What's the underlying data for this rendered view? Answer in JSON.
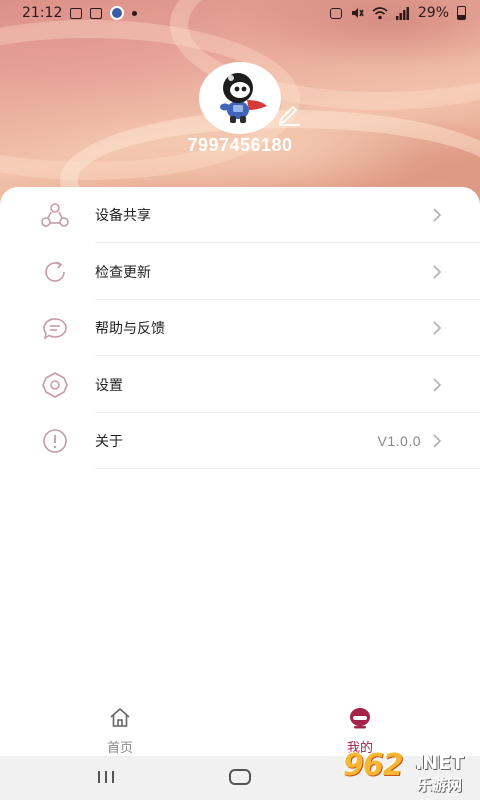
{
  "status_bar": {
    "time": "21:12",
    "battery": "29%",
    "icons": [
      "gallery-icon",
      "mail-icon",
      "app-icon",
      "dot-icon",
      "screenshot-icon",
      "mute-icon",
      "wifi-icon",
      "signal-icon",
      "battery-icon"
    ]
  },
  "profile": {
    "user_id": "7997456180",
    "avatar": "astronaut-avatar-icon",
    "edit_icon": "pencil-icon"
  },
  "menu": {
    "items": [
      {
        "label": "设备共享",
        "icon": "share-devices-icon",
        "value": ""
      },
      {
        "label": "检查更新",
        "icon": "refresh-icon",
        "value": ""
      },
      {
        "label": "帮助与反馈",
        "icon": "message-icon",
        "value": ""
      },
      {
        "label": "设置",
        "icon": "settings-gear-icon",
        "value": ""
      },
      {
        "label": "关于",
        "icon": "info-icon",
        "value": "V1.0.0"
      }
    ]
  },
  "tab_bar": {
    "tabs": [
      {
        "label": "首页",
        "icon": "home-icon",
        "active": false
      },
      {
        "label": "我的",
        "icon": "profile-icon",
        "active": true
      }
    ]
  },
  "watermark": {
    "digits": "962",
    "suffix": ".NET",
    "text": "乐游网"
  },
  "colors": {
    "accent": "#a52348",
    "icon_tint": "#c79aa6",
    "chevron": "#b0b0b0"
  }
}
